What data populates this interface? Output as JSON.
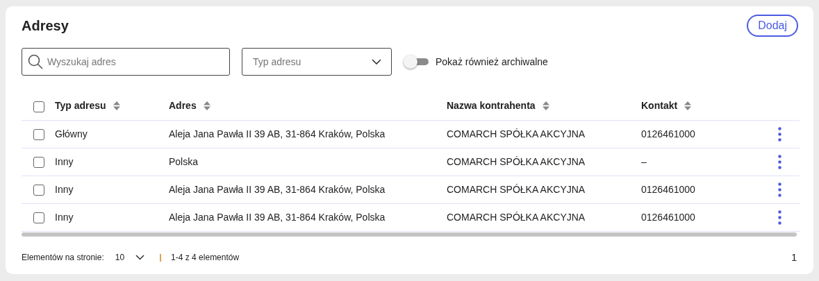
{
  "title": "Adresy",
  "add_button": "Dodaj",
  "search": {
    "placeholder": "Wyszukaj adres"
  },
  "type_select": {
    "placeholder": "Typ adresu"
  },
  "archive_toggle": {
    "label": "Pokaż również archiwalne",
    "on": false
  },
  "table": {
    "select_all": {
      "checked": false
    },
    "columns": [
      "Typ adresu",
      "Adres",
      "Nazwa kontrahenta",
      "Kontakt"
    ],
    "rows": [
      {
        "checked": false,
        "cells": [
          "Główny",
          "Aleja Jana Pawła II 39 AB, 31-864 Kraków, Polska",
          "COMARCH SPÓŁKA AKCYJNA",
          "0126461000"
        ]
      },
      {
        "checked": false,
        "cells": [
          "Inny",
          "Polska",
          "COMARCH SPÓŁKA AKCYJNA",
          "–"
        ]
      },
      {
        "checked": false,
        "cells": [
          "Inny",
          "Aleja Jana Pawła II 39 AB, 31-864 Kraków, Polska",
          "COMARCH SPÓŁKA AKCYJNA",
          "0126461000"
        ]
      },
      {
        "checked": false,
        "cells": [
          "Inny",
          "Aleja Jana Pawła II 39 AB, 31-864 Kraków, Polska",
          "COMARCH SPÓŁKA AKCYJNA",
          "0126461000"
        ]
      }
    ]
  },
  "pagination": {
    "per_page_label": "Elementów na stronie:",
    "per_page": "10",
    "range": "1-4 z 4 elementów",
    "page": "1"
  }
}
